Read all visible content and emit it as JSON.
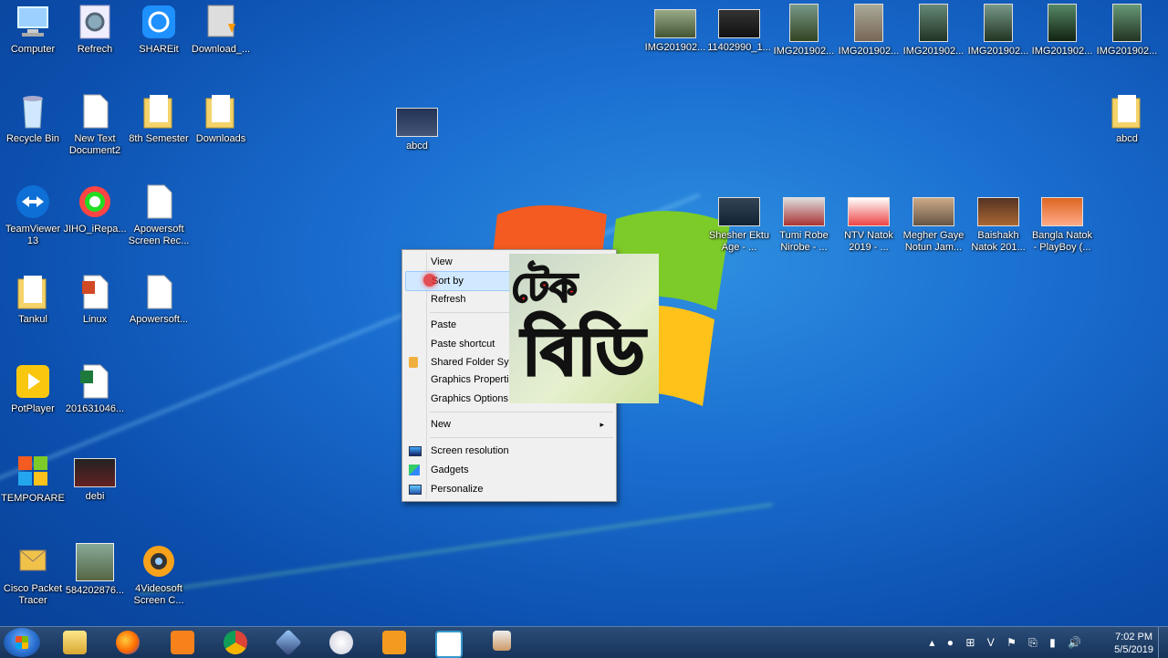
{
  "desktop": {
    "icons": [
      {
        "label": "Computer",
        "icon": "computer-icon"
      },
      {
        "label": "Refrech",
        "icon": "gear-icon"
      },
      {
        "label": "SHAREit",
        "icon": "shareit-icon"
      },
      {
        "label": "Download_...",
        "icon": "download-folder-icon"
      },
      {
        "label": "Recycle Bin",
        "icon": "recycle-bin-icon"
      },
      {
        "label": "New Text Document2",
        "icon": "text-document-icon"
      },
      {
        "label": "8th Semester",
        "icon": "folder-icon"
      },
      {
        "label": "Downloads",
        "icon": "folder-icon"
      },
      {
        "label": "TeamViewer 13",
        "icon": "teamviewer-icon"
      },
      {
        "label": "JIHO_iRepa...",
        "icon": "lifebuoy-icon"
      },
      {
        "label": "Apowersoft Screen Rec...",
        "icon": "document-icon"
      },
      {
        "label": "Tankul",
        "icon": "folder-icon"
      },
      {
        "label": "Linux",
        "icon": "powerpoint-icon"
      },
      {
        "label": "Apowersoft...",
        "icon": "document-icon"
      },
      {
        "label": "PotPlayer",
        "icon": "potplayer-icon"
      },
      {
        "label": "201631046...",
        "icon": "excel-icon"
      },
      {
        "label": "TEMPORARE",
        "icon": "windows-logo-icon"
      },
      {
        "label": "debi",
        "icon": "video-thumbnail-icon"
      },
      {
        "label": "Cisco Packet Tracer",
        "icon": "packet-tracer-icon"
      },
      {
        "label": "584202876...",
        "icon": "photo-thumbnail-icon"
      },
      {
        "label": "4Videosoft Screen C...",
        "icon": "webcam-icon"
      },
      {
        "label": "abcd",
        "icon": "video-thumbnail-icon"
      },
      {
        "label": "IMG201902...",
        "icon": "photo-thumbnail-icon"
      },
      {
        "label": "11402990_1...",
        "icon": "photo-thumbnail-icon"
      },
      {
        "label": "IMG201902...",
        "icon": "photo-thumbnail-icon"
      },
      {
        "label": "IMG201902...",
        "icon": "photo-thumbnail-icon"
      },
      {
        "label": "IMG201902...",
        "icon": "photo-thumbnail-icon"
      },
      {
        "label": "IMG201902...",
        "icon": "photo-thumbnail-icon"
      },
      {
        "label": "IMG201902...",
        "icon": "photo-thumbnail-icon"
      },
      {
        "label": "IMG201902...",
        "icon": "photo-thumbnail-icon"
      },
      {
        "label": "abcd",
        "icon": "folder-icon"
      },
      {
        "label": "Shesher Ektu Age - ...",
        "icon": "video-thumbnail-icon"
      },
      {
        "label": "Tumi Robe Nirobe - ...",
        "icon": "video-thumbnail-icon"
      },
      {
        "label": "NTV Natok 2019 - ...",
        "icon": "video-thumbnail-icon"
      },
      {
        "label": "Megher Gaye Notun Jam...",
        "icon": "video-thumbnail-icon"
      },
      {
        "label": "Baishakh Natok 201...",
        "icon": "video-thumbnail-icon"
      },
      {
        "label": "Bangla Natok - PlayBoy (...",
        "icon": "video-thumbnail-icon"
      }
    ]
  },
  "context_menu": {
    "items": [
      {
        "label": "View",
        "submenu": true
      },
      {
        "label": "Sort by",
        "submenu": true
      },
      {
        "label": "Refresh",
        "submenu": false
      },
      {
        "label": "Paste",
        "submenu": false
      },
      {
        "label": "Paste shortcut",
        "submenu": false
      },
      {
        "label": "Shared Folder Sync",
        "submenu": true
      },
      {
        "label": "Graphics Properties...",
        "submenu": false
      },
      {
        "label": "Graphics Options",
        "submenu": true
      },
      {
        "label": "New",
        "submenu": true
      },
      {
        "label": "Screen resolution",
        "submenu": false
      },
      {
        "label": "Gadgets",
        "submenu": false
      },
      {
        "label": "Personalize",
        "submenu": false
      }
    ],
    "submenu_arrow": "▸",
    "highlighted": "Sort by"
  },
  "watermark": {
    "line1": "টেক",
    "line2": "বিডি"
  },
  "taskbar": {
    "apps": [
      "file-explorer-icon",
      "firefox-icon",
      "uc-browser-icon",
      "chrome-icon",
      "virtualbox-icon",
      "paint-icon",
      "outlook-icon",
      "vlc-vc-icon",
      "contact-icon"
    ],
    "tray": "▴ ● ⊞ V ⚑ ⎘ ▮ 🔊",
    "clock_time": "7:02 PM",
    "clock_date": "5/5/2019"
  },
  "colors": {
    "desktop_bg": "#1a6ed0",
    "taskbar": "#1f3f68",
    "menu_bg": "#f0f0f0",
    "highlight": "#cde8ff"
  }
}
